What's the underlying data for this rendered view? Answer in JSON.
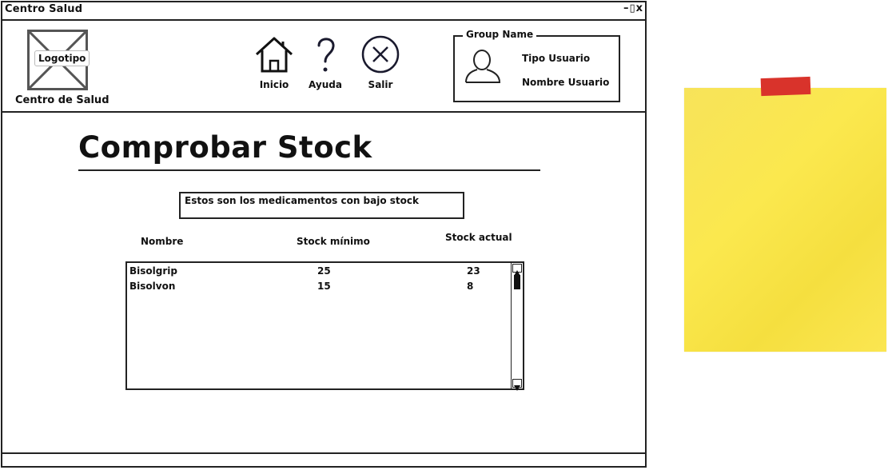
{
  "window": {
    "title": "Centro Salud",
    "controls": "–▯x"
  },
  "header": {
    "logo_label": "Logotipo",
    "logo_caption": "Centro  de Salud",
    "nav": [
      {
        "label": "Inicio",
        "icon": "home-icon"
      },
      {
        "label": "Ayuda",
        "icon": "question-mark-icon"
      },
      {
        "label": "Salir",
        "icon": "close-circle-icon"
      }
    ],
    "group": {
      "legend": "Group Name",
      "tipo_usuario": "Tipo Usuario",
      "nombre_usuario": "Nombre Usuario"
    }
  },
  "main": {
    "title": "Comprobar Stock",
    "info_text": "Estos son los medicamentos con bajo stock",
    "columns": [
      "Nombre",
      "Stock mínimo",
      "Stock actual"
    ],
    "rows": [
      {
        "nombre": "Bisolgrip",
        "stock_minimo": "25",
        "stock_actual": "23"
      },
      {
        "nombre": "Bisolvon",
        "stock_minimo": "15",
        "stock_actual": "8"
      }
    ]
  },
  "colors": {
    "sticky_note": "#f8e24d",
    "tape": "#d9332b",
    "ink": "#222222"
  }
}
